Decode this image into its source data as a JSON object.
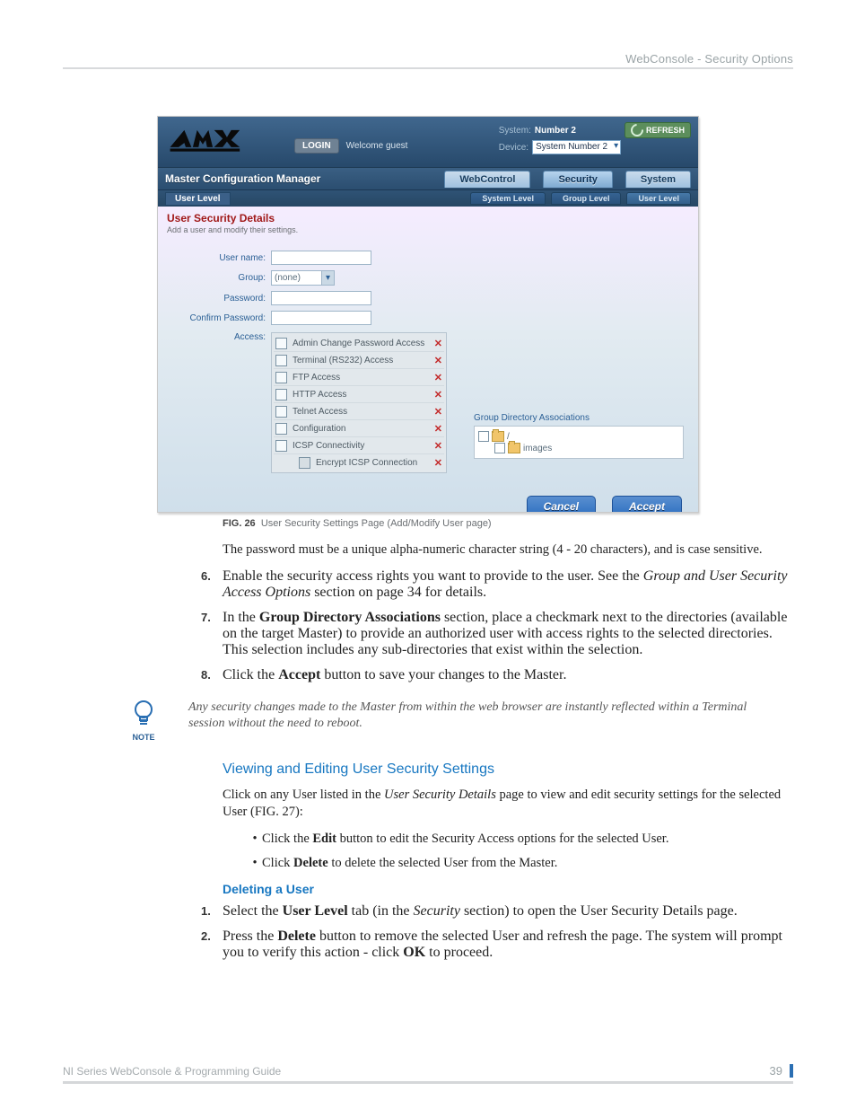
{
  "header": {
    "section": "WebConsole - Security Options"
  },
  "figure": {
    "label": "FIG. 26",
    "caption": "User Security Settings Page (Add/Modify User page)"
  },
  "screenshot": {
    "login_btn": "LOGIN",
    "welcome": "Welcome guest",
    "system_label": "System:",
    "system_value": "Number 2",
    "device_label": "Device:",
    "device_selected": "System Number 2",
    "refresh": "REFRESH",
    "title": "Master Configuration Manager",
    "tabs": {
      "web": "WebControl",
      "security": "Security",
      "system": "System"
    },
    "subtab_main": "User Level",
    "subtabs": {
      "system": "System Level",
      "group": "Group Level",
      "user": "User Level"
    },
    "section_title": "User Security Details",
    "section_sub": "Add a user and modify their settings.",
    "fields": {
      "username": "User name:",
      "group": "Group:",
      "group_selected": "(none)",
      "password": "Password:",
      "confirm": "Confirm Password:",
      "access": "Access:"
    },
    "access_items": [
      "Admin Change Password Access",
      "Terminal (RS232) Access",
      "FTP Access",
      "HTTP Access",
      "Telnet Access",
      "Configuration",
      "ICSP Connectivity",
      "Encrypt ICSP Connection"
    ],
    "gda_title": "Group Directory Associations",
    "gda_root": "/",
    "gda_images": "images",
    "cancel": "Cancel",
    "accept": "Accept"
  },
  "body": {
    "p1": "The password must be a unique alpha-numeric character string (4 - 20 characters), and is case sensitive.",
    "s6a": "Enable the security access rights you want to provide to the user. See the ",
    "s6b": "Group and User Security Access Options",
    "s6c": " section on page 34 for details.",
    "s7a": "In the ",
    "s7b": "Group Directory Associations",
    "s7c": " section, place a checkmark next to the directories (available on the target Master) to provide an authorized user with access rights to the selected directories. This selection includes any sub-directories that exist within the selection.",
    "s8a": "Click the ",
    "s8b": "Accept",
    "s8c": " button to save your changes to the Master.",
    "note": "Any security changes made to the Master from within the web browser are instantly reflected within a Terminal session without the need to reboot.",
    "note_label": "NOTE",
    "h2": "Viewing and Editing User Security Settings",
    "v1a": "Click on any User listed in the ",
    "v1b": "User Security Details",
    "v1c": " page to view and edit security settings for the selected User (FIG. 27):",
    "b1a": "Click the ",
    "b1b": "Edit",
    "b1c": " button to edit the Security Access options for the selected User.",
    "b2a": "Click ",
    "b2b": "Delete",
    "b2c": " to delete the selected User from the Master.",
    "h3": "Deleting a User",
    "d1a": "Select the ",
    "d1b": "User Level",
    "d1c": " tab (in the ",
    "d1d": "Security",
    "d1e": " section) to open the User Security Details page.",
    "d2a": "Press the ",
    "d2b": "Delete",
    "d2c": " button to remove the selected User and refresh the page. The system will prompt you to verify this action - click ",
    "d2d": "OK",
    "d2e": " to proceed."
  },
  "footer": {
    "guide": "NI Series WebConsole & Programming Guide",
    "page": "39"
  }
}
